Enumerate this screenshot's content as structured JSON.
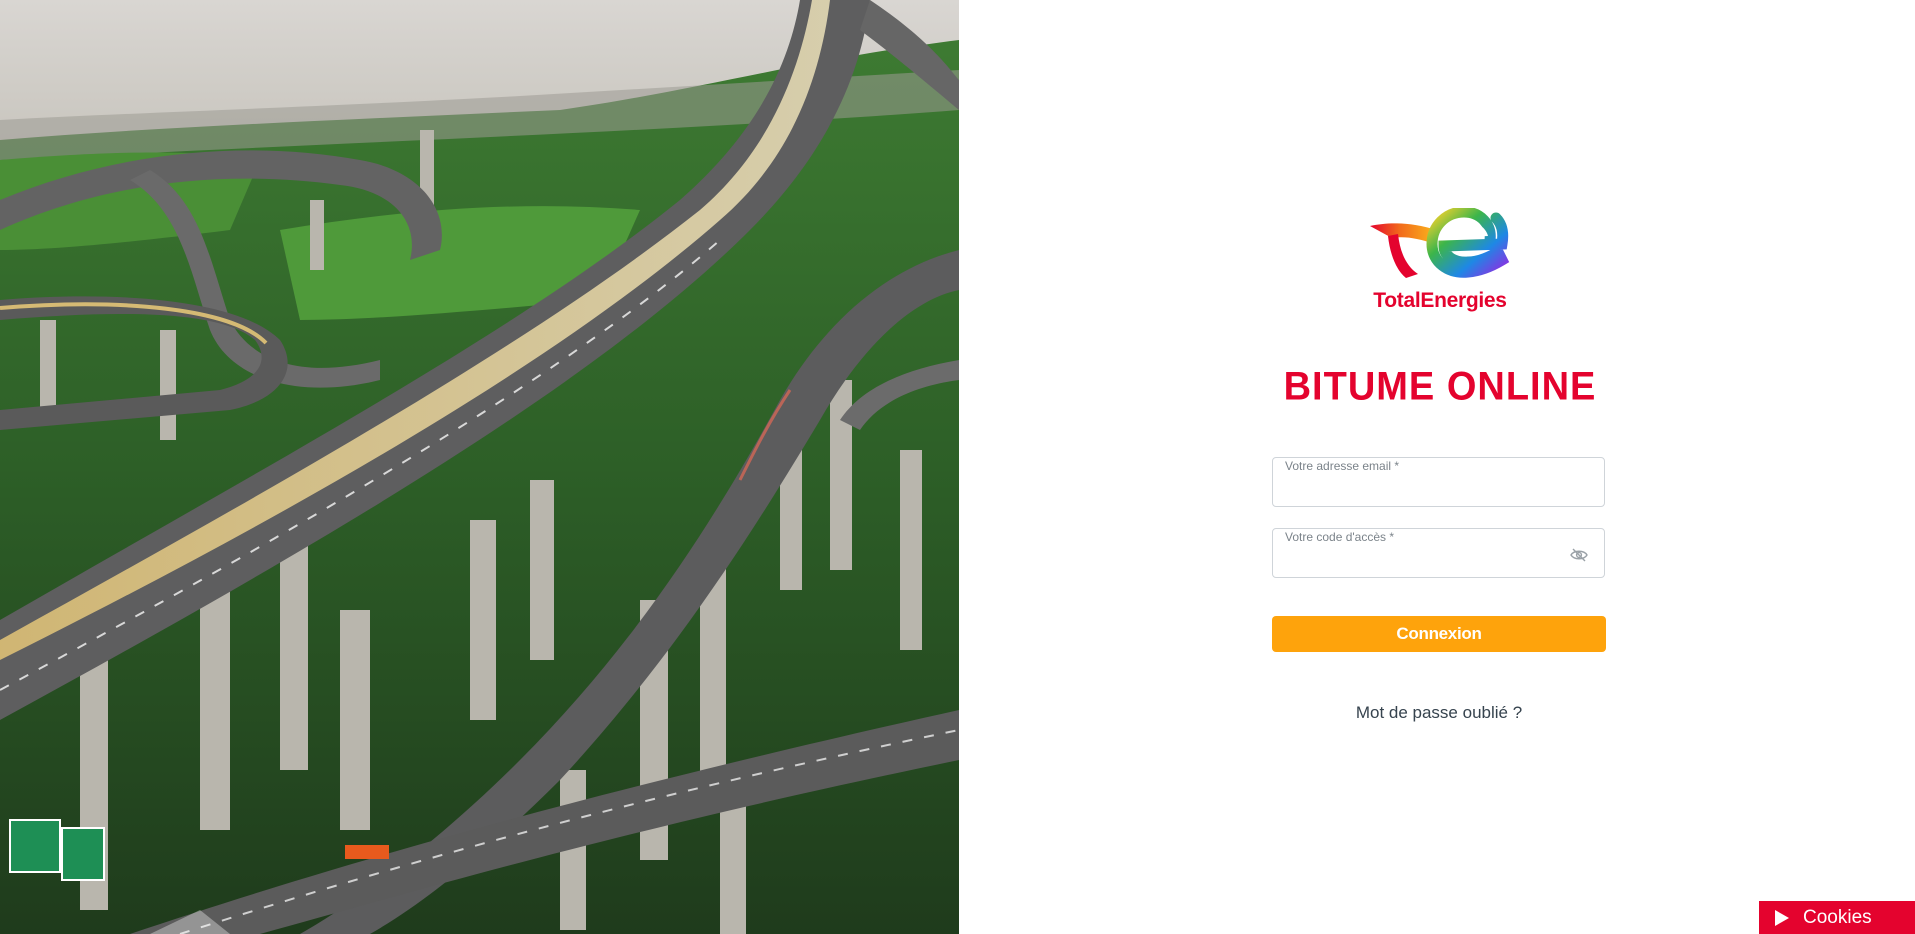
{
  "brand": {
    "name": "TotalEnergies",
    "colors": {
      "red": "#e4032e",
      "orange": "#fea30c"
    }
  },
  "hero": {
    "icon": "highway-photo"
  },
  "login": {
    "app_title": "BITUME ONLINE",
    "email_label": "Votre adresse email *",
    "email_value": "",
    "password_label": "Votre code d'accès *",
    "password_value": "",
    "password_toggle_icon": "eye-off-icon",
    "submit_label": "Connexion",
    "forgot_label": "Mot de passe oublié ?"
  },
  "cookies": {
    "label": "Cookies",
    "icon": "play-icon"
  }
}
